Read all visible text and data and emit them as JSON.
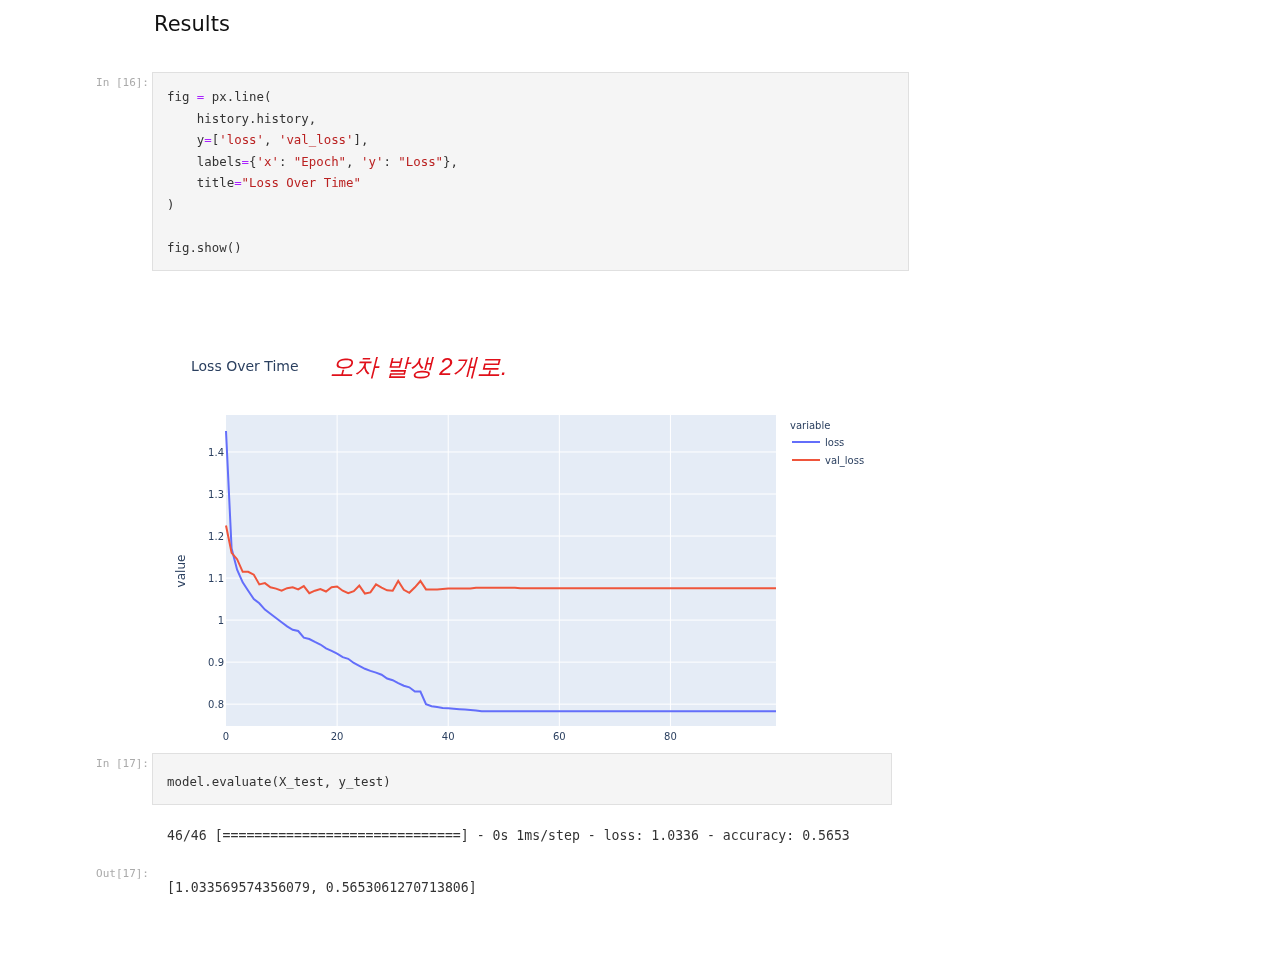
{
  "heading": "Results",
  "cells": [
    {
      "prompt": "In [16]:",
      "code": [
        [
          {
            "t": "fig ",
            "kind": "name"
          },
          {
            "t": "=",
            "kind": "op"
          },
          {
            "t": " px.line(",
            "kind": "name"
          }
        ],
        [
          {
            "t": "    history.history,",
            "kind": "name"
          }
        ],
        [
          {
            "t": "    y",
            "kind": "name"
          },
          {
            "t": "=",
            "kind": "op"
          },
          {
            "t": "[",
            "kind": "name"
          },
          {
            "t": "'loss'",
            "kind": "str"
          },
          {
            "t": ", ",
            "kind": "name"
          },
          {
            "t": "'val_loss'",
            "kind": "str"
          },
          {
            "t": "],",
            "kind": "name"
          }
        ],
        [
          {
            "t": "    labels",
            "kind": "name"
          },
          {
            "t": "=",
            "kind": "op"
          },
          {
            "t": "{",
            "kind": "name"
          },
          {
            "t": "'x'",
            "kind": "str"
          },
          {
            "t": ": ",
            "kind": "name"
          },
          {
            "t": "\"Epoch\"",
            "kind": "str"
          },
          {
            "t": ", ",
            "kind": "name"
          },
          {
            "t": "'y'",
            "kind": "str"
          },
          {
            "t": ": ",
            "kind": "name"
          },
          {
            "t": "\"Loss\"",
            "kind": "str"
          },
          {
            "t": "},",
            "kind": "name"
          }
        ],
        [
          {
            "t": "    title",
            "kind": "name"
          },
          {
            "t": "=",
            "kind": "op"
          },
          {
            "t": "\"Loss Over Time\"",
            "kind": "str"
          }
        ],
        [
          {
            "t": ")",
            "kind": "name"
          }
        ],
        [
          {
            "t": "fig.show()",
            "kind": "name",
            "gap_before": true
          }
        ]
      ],
      "figure": {
        "title": "Loss Over Time",
        "annotation": "오차 발생 2개로.",
        "chart_data": {
          "type": "line",
          "ylabel": "value",
          "grid": true,
          "legend": {
            "title": "variable"
          },
          "xlim": [
            0,
            99
          ],
          "ylim": [
            0.748,
            1.488
          ],
          "xticks": [
            0,
            20,
            40,
            60,
            80
          ],
          "yticks": [
            0.8,
            0.9,
            {
              "value": 1,
              "label": "1"
            },
            1.1,
            1.2,
            1.3,
            1.4
          ],
          "x": [
            0,
            1,
            2,
            3,
            4,
            5,
            6,
            7,
            8,
            9,
            10,
            11,
            12,
            13,
            14,
            15,
            16,
            17,
            18,
            19,
            20,
            21,
            22,
            23,
            24,
            25,
            26,
            27,
            28,
            29,
            30,
            31,
            32,
            33,
            34,
            35,
            36,
            37,
            38,
            39,
            40,
            41,
            42,
            43,
            44,
            45,
            46,
            47,
            48,
            49,
            50,
            51,
            52,
            53,
            54,
            55,
            56,
            57,
            58,
            59,
            60,
            61,
            62,
            63,
            64,
            65,
            66,
            67,
            68,
            69,
            70,
            71,
            72,
            73,
            74,
            75,
            76,
            77,
            78,
            79,
            80,
            81,
            82,
            83,
            84,
            85,
            86,
            87,
            88,
            89,
            90,
            91,
            92,
            93,
            94,
            95,
            96,
            97,
            98,
            99
          ],
          "series": [
            {
              "name": "loss",
              "color": "#636efa",
              "values": [
                1.45,
                1.17,
                1.12,
                1.09,
                1.07,
                1.05,
                1.04,
                1.025,
                1.015,
                1.005,
                0.995,
                0.985,
                0.977,
                0.974,
                0.958,
                0.955,
                0.948,
                0.942,
                0.933,
                0.927,
                0.92,
                0.912,
                0.908,
                0.898,
                0.891,
                0.884,
                0.879,
                0.875,
                0.87,
                0.861,
                0.857,
                0.85,
                0.844,
                0.84,
                0.83,
                0.83,
                0.8,
                0.795,
                0.793,
                0.791,
                0.79,
                0.789,
                0.788,
                0.787,
                0.786,
                0.785,
                0.783,
                0.783,
                0.783,
                0.783,
                0.783,
                0.783,
                0.783,
                0.783,
                0.783,
                0.783,
                0.783,
                0.783,
                0.783,
                0.783,
                0.783,
                0.783,
                0.783,
                0.783,
                0.783,
                0.783,
                0.783,
                0.783,
                0.783,
                0.783,
                0.783,
                0.783,
                0.783,
                0.783,
                0.783,
                0.783,
                0.783,
                0.783,
                0.783,
                0.783,
                0.783,
                0.783,
                0.783,
                0.783,
                0.783,
                0.783,
                0.783,
                0.783,
                0.783,
                0.783,
                0.783,
                0.783,
                0.783,
                0.783,
                0.783,
                0.783,
                0.783,
                0.783,
                0.783,
                0.783
              ]
            },
            {
              "name": "val_loss",
              "color": "#ef553b",
              "values": [
                1.225,
                1.16,
                1.145,
                1.115,
                1.115,
                1.108,
                1.085,
                1.088,
                1.078,
                1.075,
                1.07,
                1.076,
                1.078,
                1.073,
                1.081,
                1.064,
                1.07,
                1.074,
                1.068,
                1.078,
                1.08,
                1.07,
                1.064,
                1.069,
                1.082,
                1.063,
                1.066,
                1.085,
                1.077,
                1.071,
                1.07,
                1.093,
                1.072,
                1.065,
                1.078,
                1.093,
                1.073,
                1.073,
                1.073,
                1.074,
                1.075,
                1.075,
                1.075,
                1.075,
                1.075,
                1.077,
                1.077,
                1.077,
                1.077,
                1.077,
                1.077,
                1.077,
                1.077,
                1.076,
                1.076,
                1.076,
                1.076,
                1.076,
                1.076,
                1.076,
                1.076,
                1.076,
                1.076,
                1.076,
                1.076,
                1.076,
                1.076,
                1.076,
                1.076,
                1.076,
                1.076,
                1.076,
                1.076,
                1.076,
                1.076,
                1.076,
                1.076,
                1.076,
                1.076,
                1.076,
                1.076,
                1.076,
                1.076,
                1.076,
                1.076,
                1.076,
                1.076,
                1.076,
                1.076,
                1.076,
                1.076,
                1.076,
                1.076,
                1.076,
                1.076,
                1.076,
                1.076,
                1.076,
                1.076,
                1.076
              ]
            }
          ]
        }
      }
    },
    {
      "prompt": "In [17]:",
      "code": [
        [
          {
            "t": "model.evaluate(X_test, y_test)",
            "kind": "name"
          }
        ]
      ],
      "stream": "46/46 [==============================] - 0s 1ms/step - loss: 1.0336 - accuracy: 0.5653",
      "out_prompt": "Out[17]:",
      "result": "[1.033569574356079, 0.5653061270713806]"
    }
  ]
}
